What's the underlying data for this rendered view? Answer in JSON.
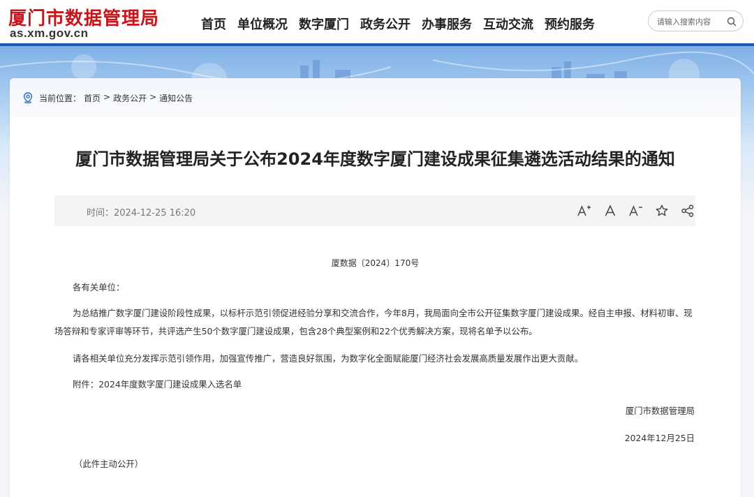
{
  "header": {
    "logo_title": "厦门市数据管理局",
    "logo_domain": "as.xm.gov.cn",
    "nav": [
      "首页",
      "单位概况",
      "数字厦门",
      "政务公开",
      "办事服务",
      "互动交流",
      "预约服务"
    ],
    "search": {
      "placeholder": "请输入搜索内容"
    }
  },
  "breadcrumb": {
    "prefix": "当前位置：",
    "items": [
      "首页",
      "政务公开",
      "通知公告"
    ],
    "separator": ">"
  },
  "article": {
    "title": "厦门市数据管理局关于公布2024年度数字厦门建设成果征集遴选活动结果的通知",
    "time_label": "时间：",
    "time_value": "2024-12-25 16:20",
    "doc_number": "厦数据〔2024〕170号",
    "salutation": "各有关单位：",
    "paragraph_1": "为总结推广数字厦门建设阶段性成果，以标杆示范引领促进经验分享和交流合作，今年8月，我局面向全市公开征集数字厦门建设成果。经自主申报、材料初审、现场答辩和专家评审等环节，共评选产生50个数字厦门建设成果，包含28个典型案例和22个优秀解决方案，现将名单予以公布。",
    "paragraph_2": "请各相关单位充分发挥示范引领作用，加强宣传推广，营造良好氛围，为数字化全面赋能厦门经济社会发展高质量发展作出更大贡献。",
    "attachment": "附件：2024年度数字厦门建设成果入选名单",
    "signature": "厦门市数据管理局",
    "date": "2024年12月25日",
    "note": "（此件主动公开）"
  },
  "tools": [
    "font-increase-icon",
    "font-normal-icon",
    "font-decrease-icon",
    "star-icon",
    "share-icon"
  ],
  "colors": {
    "brand_red": "#c6161b",
    "brand_blue": "#1a57b6"
  }
}
